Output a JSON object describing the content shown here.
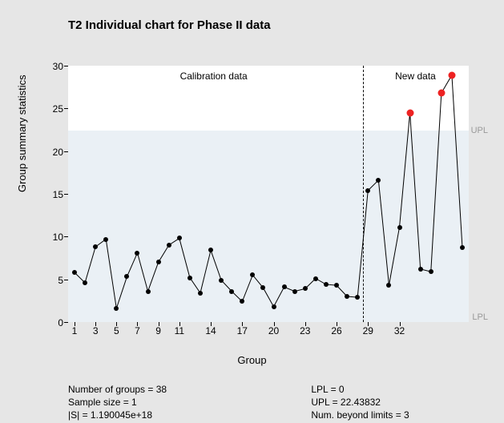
{
  "chart_data": {
    "type": "line",
    "title": "T2 Individual chart for Phase II data",
    "xlabel": "Group",
    "ylabel": "Group summary statistics",
    "ylim": [
      0,
      30
    ],
    "yticks": [
      0,
      5,
      10,
      15,
      20,
      25,
      30
    ],
    "xticks": [
      1,
      3,
      5,
      7,
      9,
      11,
      14,
      17,
      20,
      23,
      26,
      29,
      32
    ],
    "x": [
      1,
      2,
      3,
      4,
      5,
      6,
      7,
      8,
      9,
      10,
      11,
      12,
      13,
      14,
      15,
      16,
      17,
      18,
      19,
      20,
      21,
      22,
      23,
      24,
      25,
      26,
      27,
      28,
      29,
      30,
      31,
      32,
      33,
      34,
      35,
      36,
      37,
      38
    ],
    "values": [
      5.8,
      4.6,
      8.8,
      9.7,
      1.6,
      5.3,
      8.1,
      3.6,
      7.0,
      9.0,
      9.8,
      5.2,
      3.4,
      8.4,
      4.9,
      3.6,
      2.4,
      5.5,
      4.0,
      1.8,
      4.1,
      3.6,
      3.9,
      5.1,
      4.4,
      4.3,
      3.0,
      2.9,
      15.4,
      16.6,
      4.3,
      11.1,
      24.5,
      6.2,
      5.9,
      26.8,
      28.9,
      8.7
    ],
    "out_of_limit_indices": [
      33,
      36,
      37
    ],
    "phase_split_after": 28,
    "UPL": 22.43832,
    "LPL": 0,
    "regions": {
      "calibration": "Calibration data",
      "new": "New data"
    },
    "limit_labels": {
      "upl": "UPL",
      "lpl": "LPL"
    }
  },
  "footer": {
    "ngroups": "Number of groups = 38",
    "ssize": "Sample size = 1",
    "detS": "|S| = 1.190045e+18",
    "lpl": "LPL = 0",
    "upl": "UPL = 22.43832",
    "beyond": "Num. beyond limits = 3"
  }
}
